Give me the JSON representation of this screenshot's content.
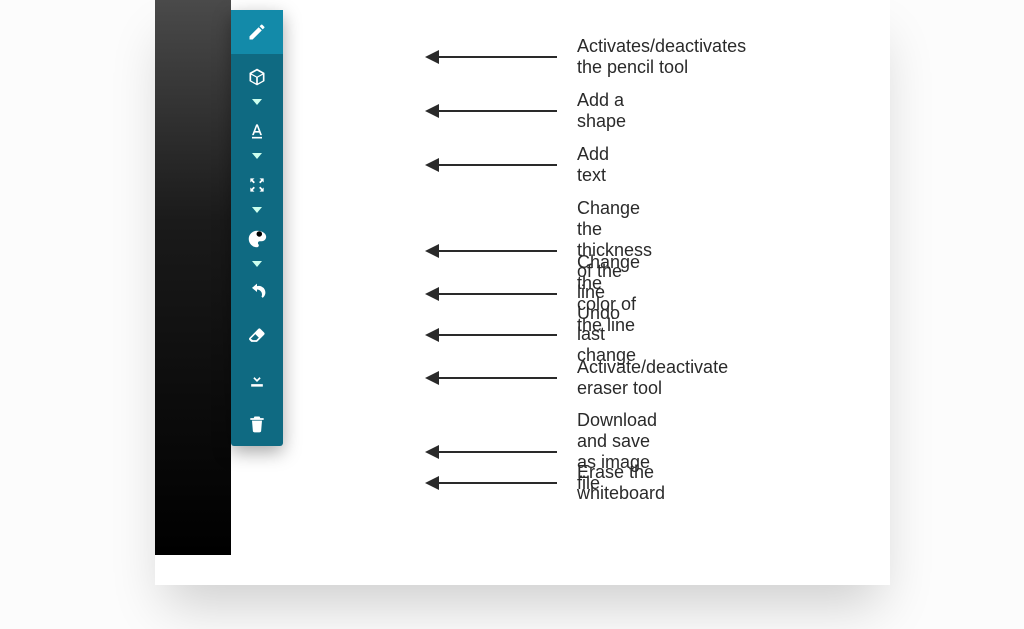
{
  "toolbar": {
    "items": [
      {
        "id": "pencil",
        "label": "Activates/deactivates the pencil tool",
        "active": true,
        "has_dropdown": false
      },
      {
        "id": "shape",
        "label": "Add a shape",
        "active": false,
        "has_dropdown": true
      },
      {
        "id": "text",
        "label": "Add text",
        "active": false,
        "has_dropdown": true
      },
      {
        "id": "thickness",
        "label": "Change the thickness of the line",
        "active": false,
        "has_dropdown": true
      },
      {
        "id": "color",
        "label": "Change the color of the line",
        "active": false,
        "has_dropdown": true
      },
      {
        "id": "undo",
        "label": "Undo last change",
        "active": false,
        "has_dropdown": false
      },
      {
        "id": "eraser",
        "label": "Activate/deactivate eraser tool",
        "active": false,
        "has_dropdown": false
      },
      {
        "id": "download",
        "label": "Download and save as image file",
        "active": false,
        "has_dropdown": false
      },
      {
        "id": "clear",
        "label": "Erase the whiteboard",
        "active": false,
        "has_dropdown": false
      }
    ]
  },
  "row_offsets": [
    32,
    60,
    114,
    168,
    222,
    276,
    327,
    381,
    434,
    486
  ]
}
